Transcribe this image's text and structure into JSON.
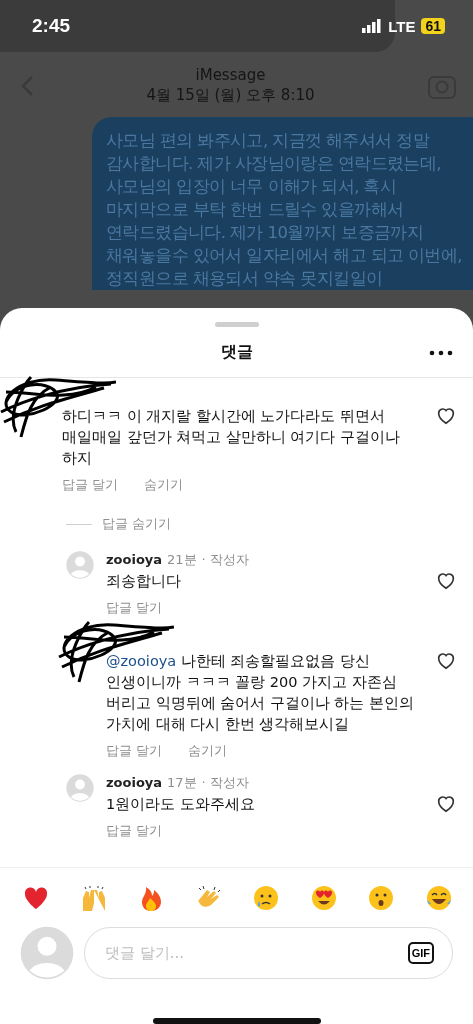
{
  "status_bar": {
    "time": "2:45",
    "network": "LTE",
    "battery": "61"
  },
  "background_chat": {
    "title": "iMessage",
    "date": "4월 15일 (월) 오후 8:10",
    "message": "사모님 편의 봐주시고, 지금껏 해주셔서 정말 감사합니다. 제가 사장님이랑은 연락드렸는데, 사모님의 입장이 너무 이해가 되서, 혹시 마지막으로 부탁 한번 드릴수 있을까해서 연락드렸습니다. 제가 10월까지 보증금까지 채워놓을수 있어서 일자리에서 해고 되고 이번에, 정직원으로 채용되서 약속 못지킬일이"
  },
  "sheet": {
    "title": "댓글"
  },
  "comments": [
    {
      "kind": "redacted",
      "text": "하디ㅋㅋ 이 개지랄 할시간에 노가다라도 뛰면서 매일매일 갚던가 쳐먹고 살만하니 여기다 구걸이나 하지",
      "actions": [
        "답글 달기",
        "숨기기"
      ],
      "replies_toggle": "답글 숨기기",
      "children": [
        {
          "kind": "plain",
          "username": "zooioya",
          "time": "21분",
          "badge": "· 작성자",
          "text": "죄송합니다",
          "actions": [
            "답글 달기"
          ]
        },
        {
          "kind": "redacted",
          "mention": "@zooioya",
          "text": "나한테 죄송할필요없음 당신 인생이니까 ㅋㅋㅋ 꼴랑 200 가지고 자존심 버리고 익명뒤에 숨어서 구걸이나 하는 본인의 가치에 대해 다시 한번 생각해보시길",
          "actions": [
            "답글 달기",
            "숨기기"
          ]
        },
        {
          "kind": "plain",
          "username": "zooioya",
          "time": "17분",
          "badge": "· 작성자",
          "text": "1원이라도 도와주세요",
          "actions": [
            "답글 달기"
          ]
        }
      ]
    }
  ],
  "composer": {
    "placeholder": "댓글 달기...",
    "gif": "GIF"
  }
}
